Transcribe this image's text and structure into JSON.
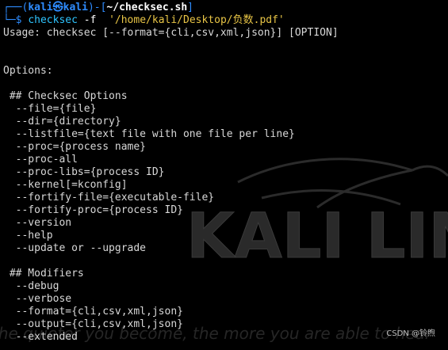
{
  "colors": {
    "background": "#000000",
    "prompt_frame": "#2e8cff",
    "command": "#2ec4ff",
    "path_string": "#e8c546",
    "output_text": "#d8d8d8"
  },
  "prompt": {
    "frame_open": "┌──(",
    "user_host": "kali㉿kali",
    "frame_mid": ")-[",
    "directory": "~/checksec.sh",
    "frame_close": "]",
    "input_marker": "└─$ ",
    "command": "checksec",
    "flag": " -f  ",
    "argument": "'/home/kali/Desktop/负数.pdf'"
  },
  "output_lines": [
    "Usage: checksec [--format={cli,csv,xml,json}] [OPTION]",
    "",
    "",
    "Options:",
    "",
    " ## Checksec Options",
    "  --file={file}",
    "  --dir={directory}",
    "  --listfile={text file with one file per line}",
    "  --proc={process name}",
    "  --proc-all",
    "  --proc-libs={process ID}",
    "  --kernel[=kconfig]",
    "  --fortify-file={executable-file}",
    "  --fortify-proc={process ID}",
    "  --version",
    "  --help",
    "  --update or --upgrade",
    "",
    " ## Modifiers",
    "  --debug",
    "  --verbose",
    "  --format={cli,csv,xml,json}",
    "  --output={cli,csv,xml,json}",
    "  --extended"
  ],
  "watermark": {
    "title": "KALI LINUX",
    "tagline": "the quieter you become, the more you are able to hear"
  },
  "footer": {
    "credit": "CSDN @铃煦"
  }
}
